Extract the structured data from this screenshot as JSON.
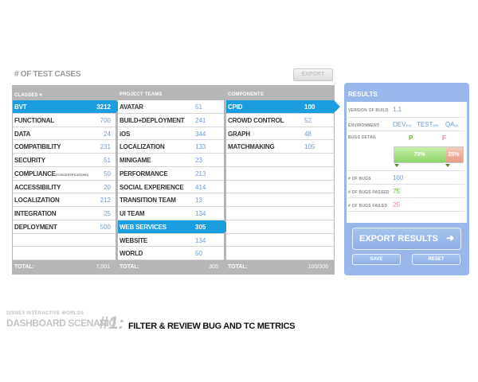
{
  "page": {
    "title": "# OF TEST CASES",
    "export_button": "EXPORT"
  },
  "columns": [
    {
      "header": "CLASSES ▾",
      "rows": [
        {
          "label": "BVT",
          "value": "3212",
          "selected": true
        },
        {
          "label": "FUNCTIONAL",
          "value": "700"
        },
        {
          "label": "DATA",
          "value": "24"
        },
        {
          "label": "COMPATIBILITY",
          "value": "231"
        },
        {
          "label": "SECURITY",
          "value": "51"
        },
        {
          "label": "COMPLIANCE",
          "small": "(TCR/CERTIFICATIONS)",
          "value": "50"
        },
        {
          "label": "ACCESSIBILITY",
          "value": "20"
        },
        {
          "label": "LOCALIZATION",
          "value": "212"
        },
        {
          "label": "INTEGRATION",
          "value": "25"
        },
        {
          "label": "DEPLOYMENT",
          "value": "500"
        },
        {
          "label": "",
          "value": ""
        },
        {
          "label": "",
          "value": ""
        }
      ],
      "total_label": "TOTAL:",
      "total_value": "7,001"
    },
    {
      "header": "PROJECT TEAMS",
      "rows": [
        {
          "label": "AVATAR",
          "value": "51"
        },
        {
          "label": "BUILD+DEPLOYMENT",
          "value": "241"
        },
        {
          "label": "iOS",
          "value": "344"
        },
        {
          "label": "LOCALIZATION",
          "value": "133"
        },
        {
          "label": "MINIGAME",
          "value": "23"
        },
        {
          "label": "PERFORMANCE",
          "value": "213"
        },
        {
          "label": "SOCIAL EXPERIENCE",
          "value": "414"
        },
        {
          "label": "TRANSITION TEAM",
          "value": "13"
        },
        {
          "label": "UI TEAM",
          "value": "134"
        },
        {
          "label": "WEB SERVICES",
          "value": "305",
          "selected": true
        },
        {
          "label": "WEBSITE",
          "value": "134"
        },
        {
          "label": "WORLD",
          "value": "50"
        }
      ],
      "total_label": "TOTAL:",
      "total_value": "305"
    },
    {
      "header": "COMPONENTS",
      "rows": [
        {
          "label": "CPID",
          "value": "100",
          "selected": true
        },
        {
          "label": "CROWD CONTROL",
          "value": "52"
        },
        {
          "label": "GRAPH",
          "value": "48"
        },
        {
          "label": "MATCHMAKING",
          "value": "105"
        },
        {
          "label": "",
          "value": ""
        },
        {
          "label": "",
          "value": ""
        },
        {
          "label": "",
          "value": ""
        },
        {
          "label": "",
          "value": ""
        },
        {
          "label": "",
          "value": ""
        },
        {
          "label": "",
          "value": ""
        },
        {
          "label": "",
          "value": ""
        },
        {
          "label": "",
          "value": ""
        }
      ],
      "total_label": "TOTAL:",
      "total_value": "100/306"
    }
  ],
  "results": {
    "header": "RESULTS",
    "version_label": "VERSION OF BUILD",
    "version_value": "1.1",
    "environment_label": "ENVIRONMENT",
    "env_dev": "DEV",
    "env_dev_count": "(15)",
    "env_test": "TEST",
    "env_test_count": "(85)",
    "env_qa": "QA",
    "env_qa_count": "(0)",
    "bug_detail_label": "BUGS DETAIL",
    "pass_letter": "P",
    "fail_letter": "F",
    "pass_pct": "75%",
    "fail_pct": "25%",
    "pass_fraction": 0.75,
    "fail_fraction": 0.25,
    "bugs_label": "# OF BUGS",
    "bugs_value": "100",
    "passed_label": "# OF BUGS PASSED",
    "passed_value": "75",
    "failed_label": "# OF BUGS FAILED",
    "failed_value": "25",
    "export_results": "EXPORT RESULTS",
    "save": "SAVE",
    "reset": "RESET"
  },
  "footer": {
    "brand": "DISNEY INTERACTIVE WORLDS",
    "scenario": "DASHBOARD SCENARIO",
    "number": "#1:",
    "description": "FILTER & REVIEW BUG AND TC METRICS"
  },
  "colors": {
    "accent": "#1a9ee0",
    "value_blue": "#6e9bd8",
    "pass_green": "#5fbf2a",
    "fail_red": "#e87f9a",
    "panel_blue": "#98b8ec"
  }
}
